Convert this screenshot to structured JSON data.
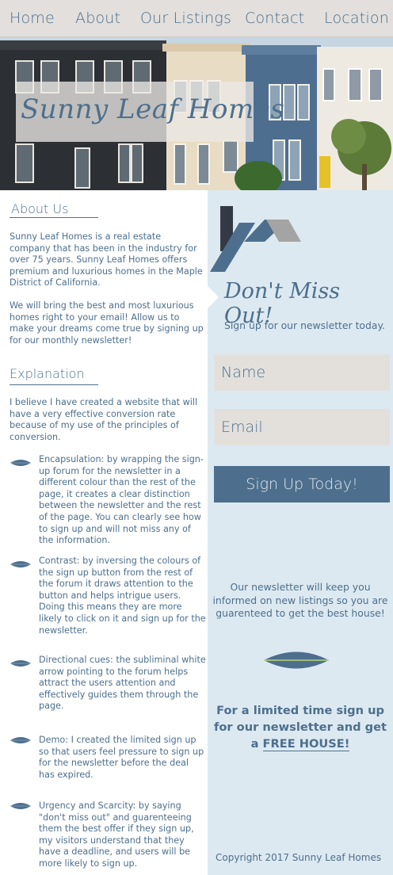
{
  "nav": {
    "items": [
      "Home",
      "About",
      "Our Listings",
      "Contact",
      "Location"
    ]
  },
  "hero": {
    "brand": "Sunny Leaf Homes"
  },
  "about": {
    "heading": "About Us",
    "p1": "Sunny Leaf Homes is a real estate company that has been in the industry for over 75 years. Sunny Leaf Homes offers premium and luxurious homes in the Maple District of California.",
    "p2": "We will bring the best and most luxurious homes right to your email! Allow us to make your dreams come true by signing up for our monthly newsletter!"
  },
  "explanation": {
    "heading": "Explanation",
    "intro": "I believe I have created a website that will have a very effective conversion rate because of my use of the principles of conversion.",
    "items": [
      "Encapsulation: by wrapping the sign-up forum for the newsletter in a different colour than the rest of the page, it creates a clear distinction between the newsletter and the rest of the page. You can clearly see how to sign up and will not miss any of the information.",
      "Contrast: by inversing the colours of the sign up button from the rest of the forum it draws attention to the button and helps intrigue users. Doing this means they are more likely to click on it and sign up for the newsletter.",
      "Directional cues: the subliminal white arrow pointing to the forum helps attract the users attention and effectively guides them through the page.",
      "Demo: I created the limited sign up so that users feel pressure to sign up for the newsletter before the deal has expired.",
      "Urgency and Scarcity: by saying \"don't miss out\" and guarenteeing them the best offer if they sign up, my visitors understand that they have a deadline, and users will be more likely to sign up."
    ]
  },
  "signup": {
    "headline": "Don't Miss Out!",
    "sub": "Sign up for our newsletter today.",
    "name_placeholder": "Name",
    "email_placeholder": "Email",
    "button": "Sign Up Today!",
    "news_text": "Our newsletter will keep you informed on new listings so you are guarenteed to get the best house!",
    "offer_text": "For a limited time sign up for our newsletter and get a",
    "offer_link": "FREE HOUSE!",
    "copyright": "Copyright 2017 Sunny Leaf Homes"
  },
  "colors": {
    "brand": "#4d6f8d",
    "panel": "#dde9f1",
    "nav": "#e2dfdc"
  }
}
